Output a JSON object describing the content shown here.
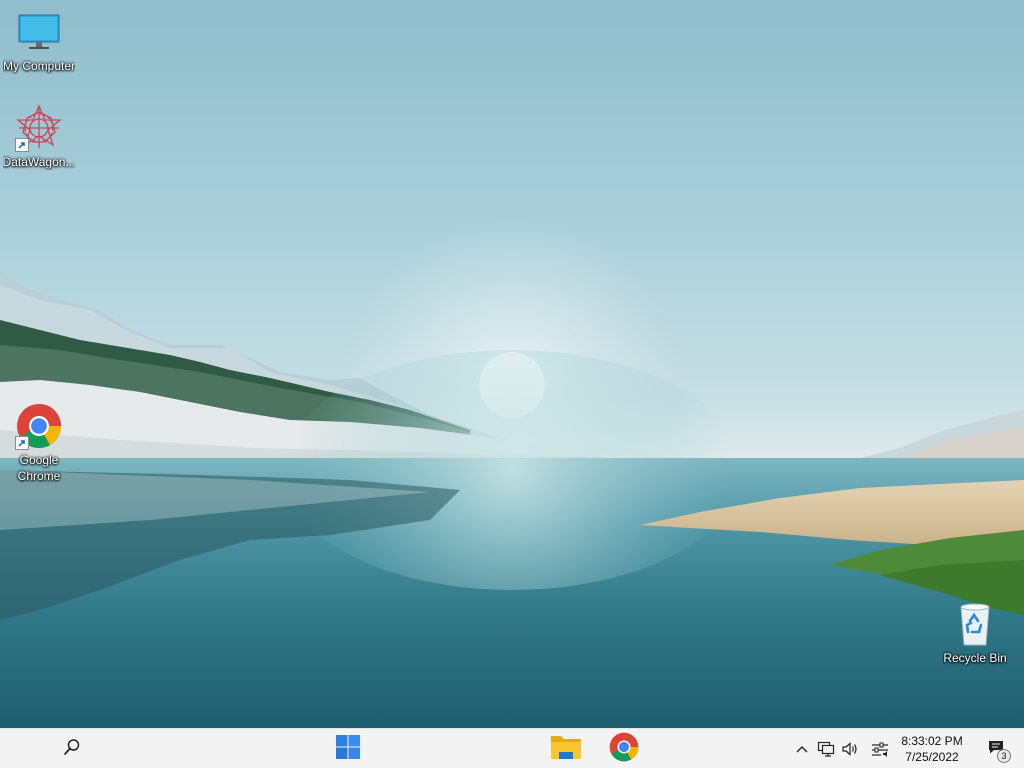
{
  "desktop": {
    "icons": [
      {
        "label": "My Computer",
        "icon": "monitor-icon",
        "shortcut": false
      },
      {
        "label": "DataWagon...",
        "icon": "datawagon-icon",
        "shortcut": true
      },
      {
        "label": "Google Chrome",
        "icon": "chrome-icon",
        "shortcut": true
      },
      {
        "label": "Recycle Bin",
        "icon": "recycle-bin-icon",
        "shortcut": false
      }
    ]
  },
  "taskbar": {
    "search_icon": "search-icon",
    "start_icon": "windows-start-icon",
    "pinned_apps": [
      {
        "name": "File Explorer",
        "icon": "folder-icon"
      },
      {
        "name": "Google Chrome",
        "icon": "chrome-icon"
      }
    ],
    "tray_icons": [
      "chevron-up-icon",
      "network-icon",
      "volume-icon",
      "settings-sliders-icon"
    ],
    "clock": {
      "time": "8:33:02 PM",
      "date": "7/25/2022"
    },
    "notifications": {
      "icon": "notification-icon",
      "count": "3"
    }
  },
  "colors": {
    "taskbar_bg": "#f3f3f3",
    "start_blue": "#2f7fe0",
    "chrome_red": "#db4437",
    "chrome_green": "#0f9d58",
    "chrome_yellow": "#f4b400",
    "chrome_blue": "#4285f4"
  }
}
